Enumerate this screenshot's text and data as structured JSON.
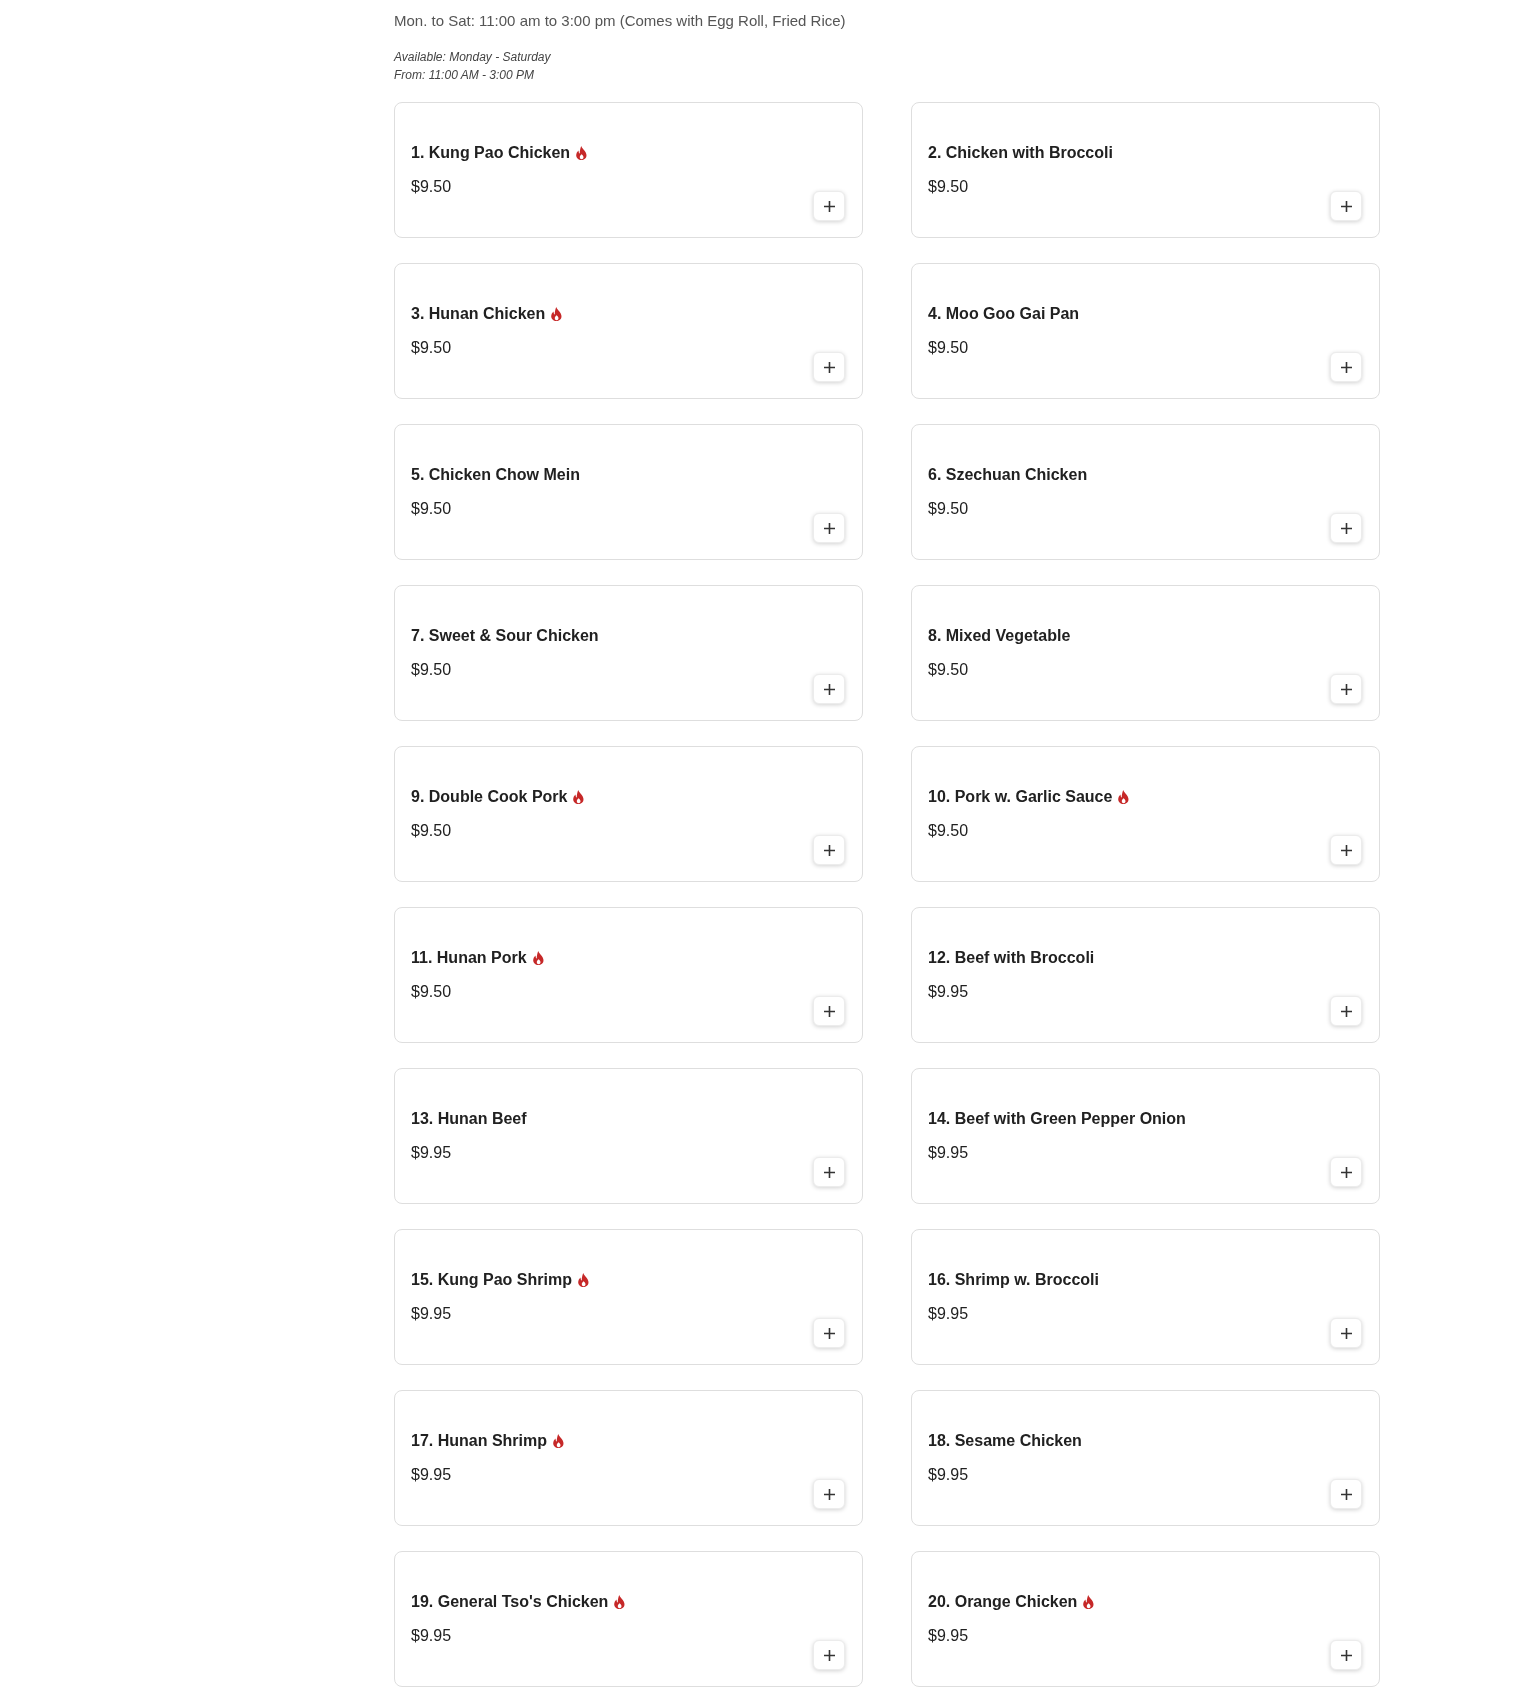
{
  "section": {
    "hours": "Mon. to Sat: 11:00 am to 3:00 pm (Comes with Egg Roll, Fried Rice)",
    "availability": [
      "Available: Monday - Saturday",
      "From: 11:00 AM - 3:00 PM"
    ]
  },
  "items": [
    {
      "name": "1. Kung Pao Chicken",
      "spicy": true,
      "price": "$9.50"
    },
    {
      "name": "2. Chicken with Broccoli",
      "spicy": false,
      "price": "$9.50"
    },
    {
      "name": "3. Hunan Chicken",
      "spicy": true,
      "price": "$9.50"
    },
    {
      "name": "4. Moo Goo Gai Pan",
      "spicy": false,
      "price": "$9.50"
    },
    {
      "name": "5. Chicken Chow Mein",
      "spicy": false,
      "price": "$9.50"
    },
    {
      "name": "6. Szechuan Chicken",
      "spicy": false,
      "price": "$9.50"
    },
    {
      "name": "7. Sweet & Sour Chicken",
      "spicy": false,
      "price": "$9.50"
    },
    {
      "name": "8. Mixed Vegetable",
      "spicy": false,
      "price": "$9.50"
    },
    {
      "name": "9. Double Cook Pork",
      "spicy": true,
      "price": "$9.50"
    },
    {
      "name": "10. Pork w. Garlic Sauce",
      "spicy": true,
      "price": "$9.50"
    },
    {
      "name": "11. Hunan Pork",
      "spicy": true,
      "price": "$9.50"
    },
    {
      "name": "12. Beef with Broccoli",
      "spicy": false,
      "price": "$9.95"
    },
    {
      "name": "13. Hunan Beef",
      "spicy": false,
      "price": "$9.95"
    },
    {
      "name": "14. Beef with Green Pepper Onion",
      "spicy": false,
      "price": "$9.95"
    },
    {
      "name": "15. Kung Pao Shrimp",
      "spicy": true,
      "price": "$9.95"
    },
    {
      "name": "16. Shrimp w. Broccoli",
      "spicy": false,
      "price": "$9.95"
    },
    {
      "name": "17. Hunan Shrimp",
      "spicy": true,
      "price": "$9.95"
    },
    {
      "name": "18. Sesame Chicken",
      "spicy": false,
      "price": "$9.95"
    },
    {
      "name": "19. General Tso's Chicken",
      "spicy": true,
      "price": "$9.95"
    },
    {
      "name": "20. Orange Chicken",
      "spicy": true,
      "price": "$9.95"
    }
  ]
}
